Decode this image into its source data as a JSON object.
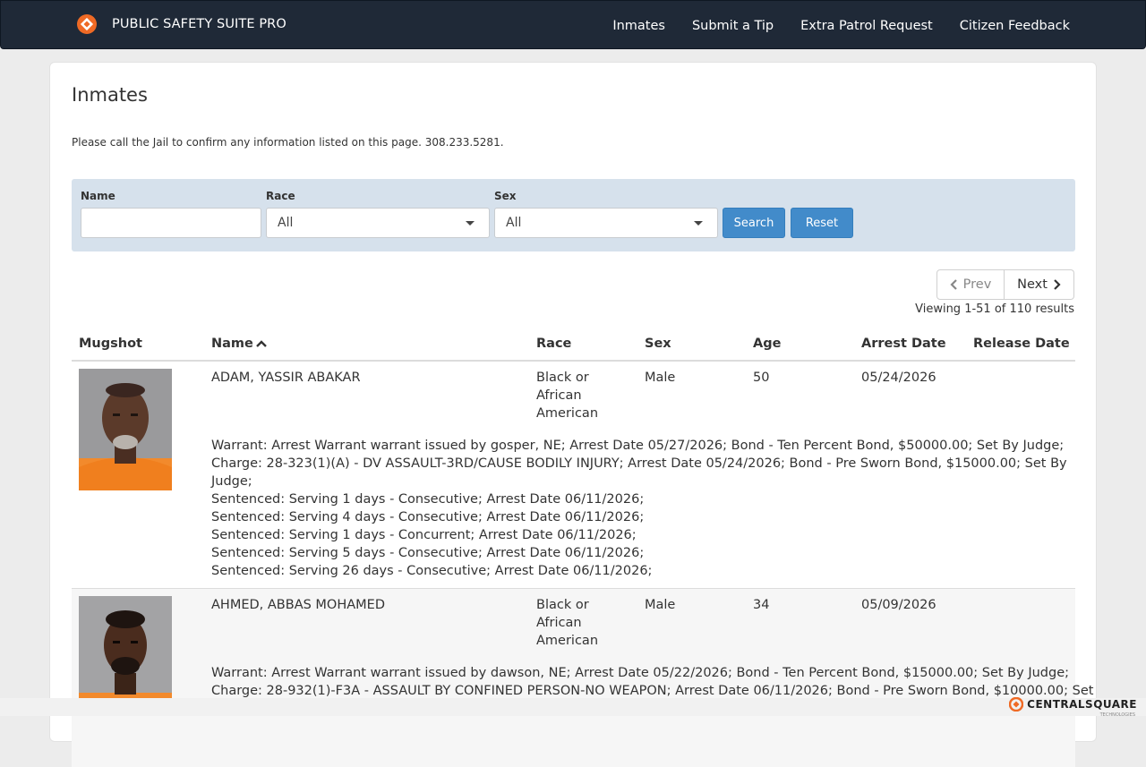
{
  "navbar": {
    "brand": "PUBLIC SAFETY SUITE PRO",
    "links": [
      "Inmates",
      "Submit a Tip",
      "Extra Patrol Request",
      "Citizen Feedback"
    ]
  },
  "page": {
    "title": "Inmates",
    "notice": "Please call the Jail to confirm any information listed on this page.  308.233.5281."
  },
  "search": {
    "name_label": "Name",
    "name_value": "",
    "race_label": "Race",
    "race_value": "All",
    "sex_label": "Sex",
    "sex_value": "All",
    "search_label": "Search",
    "reset_label": "Reset"
  },
  "pager": {
    "prev_label": "Prev",
    "next_label": "Next",
    "viewing": "Viewing 1-51 of 110 results"
  },
  "table": {
    "headers": [
      "Mugshot",
      "Name",
      "Race",
      "Sex",
      "Age",
      "Arrest Date",
      "Release Date"
    ],
    "rows": [
      {
        "name": "ADAM, YASSIR ABAKAR",
        "race": [
          "Black or",
          "African",
          "American"
        ],
        "sex": "Male",
        "age": "50",
        "arrest_date": "05/24/2026",
        "release_date": "",
        "details": [
          "Warrant: Arrest Warrant warrant issued by gosper, NE; Arrest Date 05/27/2026; Bond - Ten Percent Bond, $50000.00; Set By Judge;",
          "Charge: 28-323(1)(A) - DV ASSAULT-3RD/CAUSE BODILY INJURY; Arrest Date 05/24/2026; Bond - Pre Sworn Bond, $15000.00; Set By",
          "Judge;",
          "Sentenced: Serving 1 days - Consecutive; Arrest Date 06/11/2026;",
          "Sentenced: Serving 4 days - Consecutive; Arrest Date 06/11/2026;",
          "Sentenced: Serving 1 days - Concurrent; Arrest Date 06/11/2026;",
          "Sentenced: Serving 5 days - Consecutive; Arrest Date 06/11/2026;",
          "Sentenced: Serving 26 days - Consecutive; Arrest Date 06/11/2026;"
        ]
      },
      {
        "name": "AHMED, ABBAS MOHAMED",
        "race": [
          "Black or",
          "African",
          "American"
        ],
        "sex": "Male",
        "age": "34",
        "arrest_date": "05/09/2026",
        "release_date": "",
        "details": [
          "Warrant: Arrest Warrant warrant issued by dawson, NE; Arrest Date 05/22/2026; Bond - Ten Percent Bond, $15000.00; Set By Judge;",
          "Charge: 28-932(1)-F3A - ASSAULT BY CONFINED PERSON-NO WEAPON; Arrest Date 06/11/2026; Bond - Pre Sworn Bond, $10000.00; Set"
        ]
      }
    ]
  },
  "footer": {
    "logo_text": "CENTRALSQUARE",
    "logo_sub": "TECHNOLOGIES"
  },
  "colors": {
    "navbar": "#1f2937",
    "accent": "#428bca",
    "brand_orange": "#ef6a25"
  }
}
